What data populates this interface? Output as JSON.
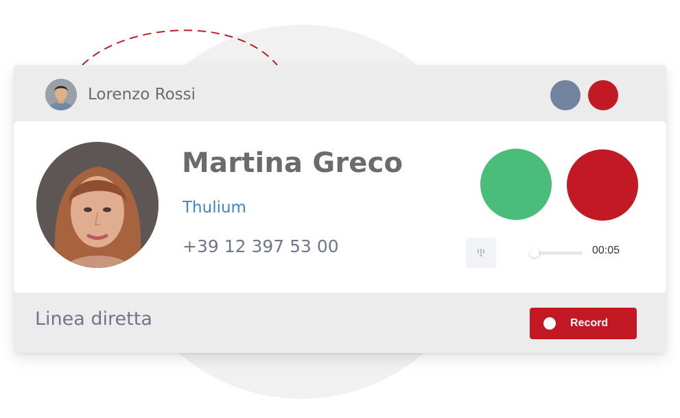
{
  "window": {
    "agent_name": "Lorenzo Rossi",
    "controls": [
      "gray-dot-icon",
      "red-dot-icon"
    ]
  },
  "contact": {
    "name": "Martina Greco",
    "company": "Thulium",
    "phone": "+39 12 397 53 00"
  },
  "call": {
    "answer_icon": "answer-call-icon",
    "reject_icon": "reject-call-icon",
    "timer": "00:05",
    "progress": 0.05
  },
  "footer": {
    "line_label": "Linea diretta",
    "record_label": "Record"
  },
  "colors": {
    "accent_red": "#c21924",
    "answer_green": "#49bd79",
    "link_blue": "#3f86c6",
    "neutral_gray": "#71839f"
  }
}
